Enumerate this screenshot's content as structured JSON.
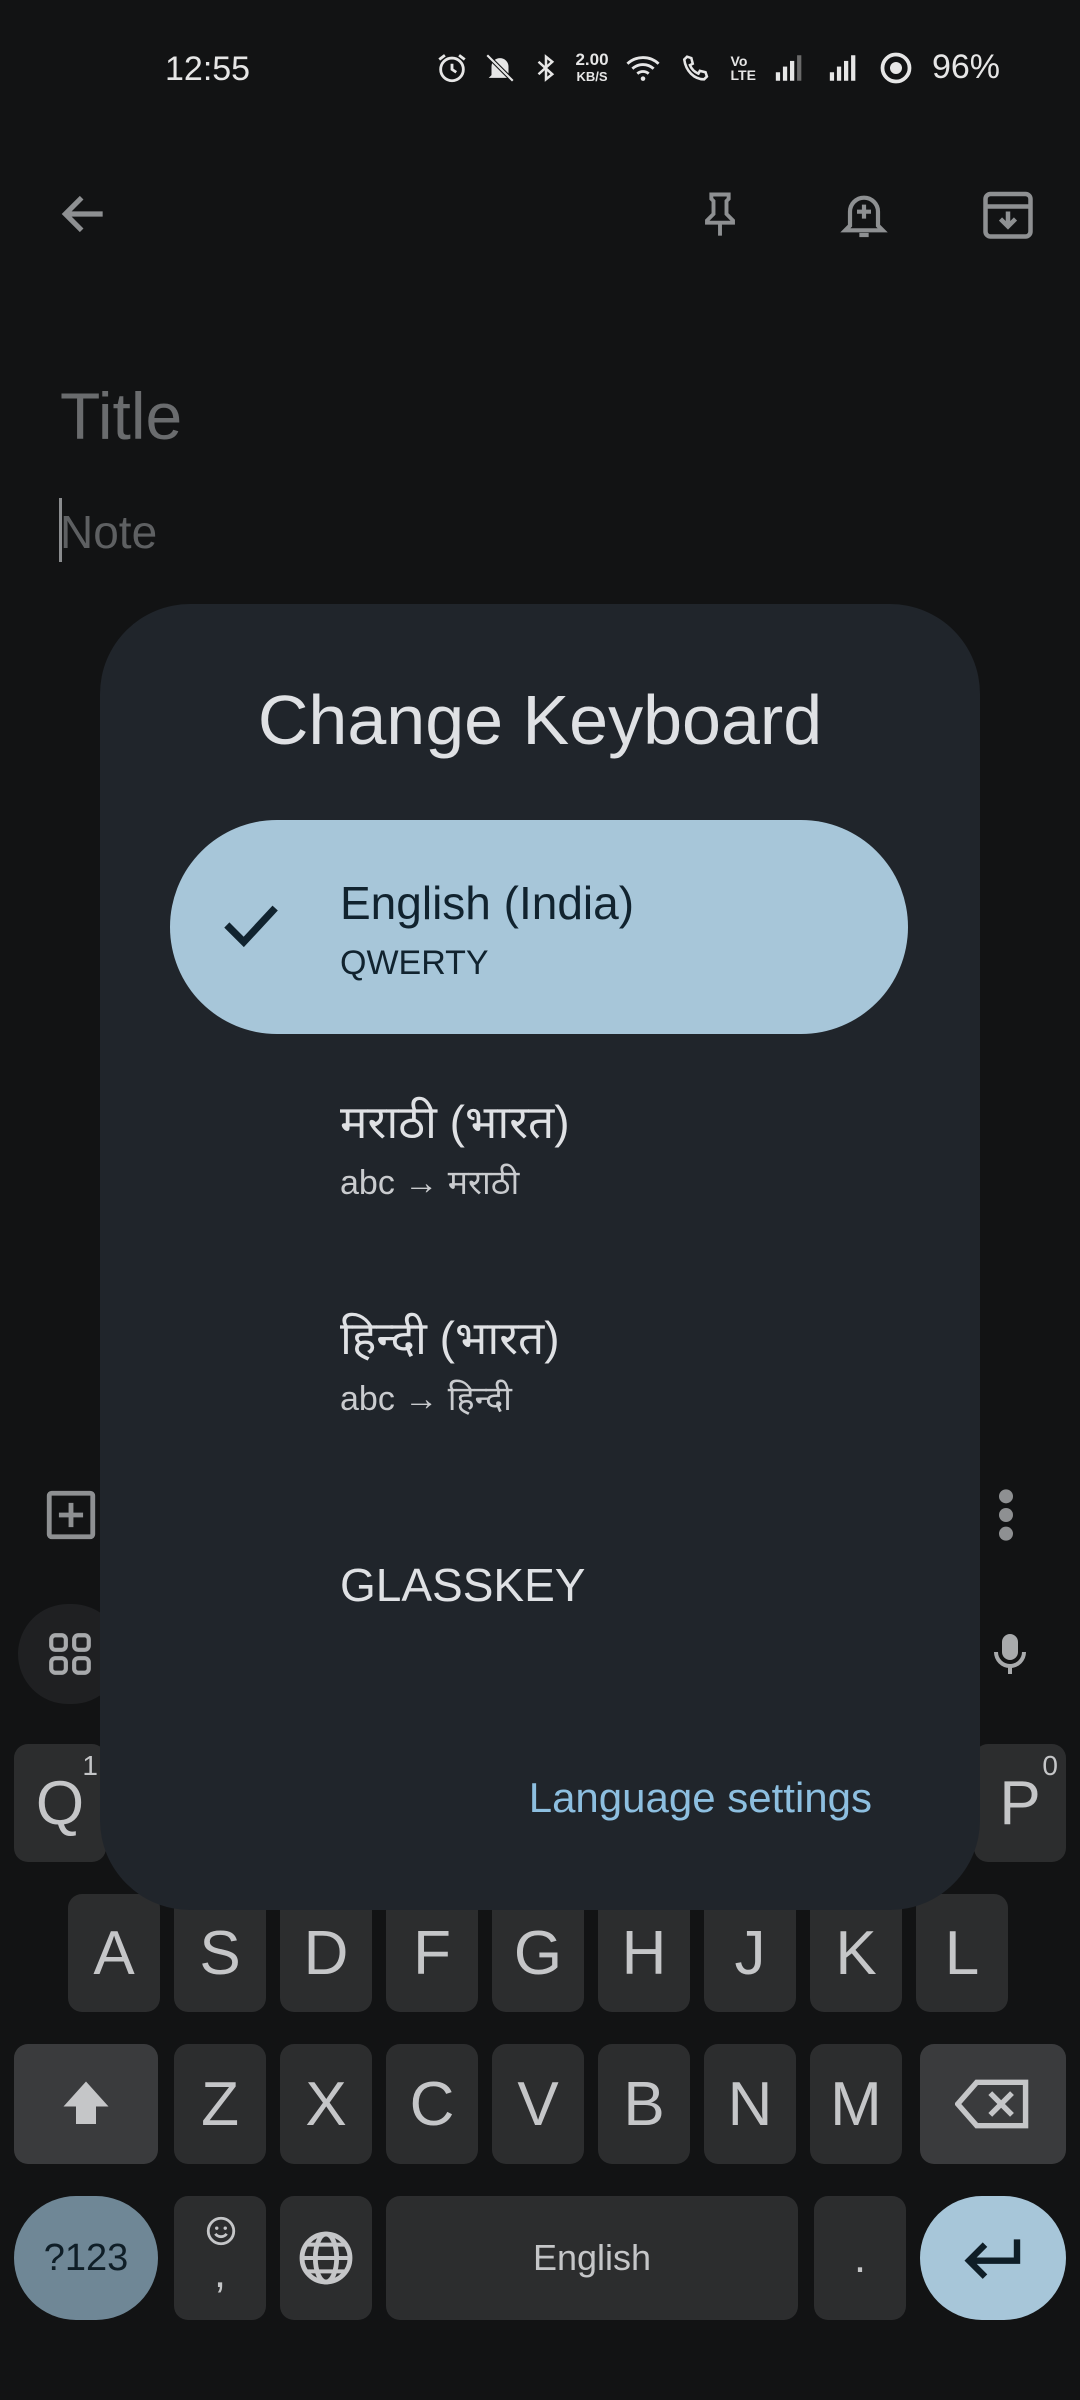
{
  "status_bar": {
    "time": "12:55",
    "network_speed_top": "2.00",
    "network_speed_bottom": "KB/S",
    "battery": "96%"
  },
  "note": {
    "title_placeholder": "Title",
    "body_placeholder": "Note"
  },
  "dialog": {
    "title": "Change Keyboard",
    "options": [
      {
        "label": "English (India)",
        "sub": "QWERTY",
        "selected": true
      },
      {
        "label": "मराठी (भारत)",
        "sub": "abc → मराठी",
        "selected": false
      },
      {
        "label": "हिन्दी (भारत)",
        "sub": "abc → हिन्दी",
        "selected": false
      },
      {
        "label": "GLASSKEY",
        "sub": "",
        "selected": false
      }
    ],
    "language_settings": "Language settings"
  },
  "keyboard": {
    "row1_left": {
      "label": "Q",
      "hint": "1"
    },
    "row1_right": {
      "label": "P",
      "hint": "0"
    },
    "row2": [
      "A",
      "S",
      "D",
      "F",
      "G",
      "H",
      "J",
      "K",
      "L"
    ],
    "row3": [
      "Z",
      "X",
      "C",
      "V",
      "B",
      "N",
      "M"
    ],
    "symbols_label": "?123",
    "comma_label": ",",
    "space_label": "English",
    "period_label": "."
  },
  "colors": {
    "accent": "#a7c6d9",
    "link": "#8dbfe0",
    "dialog_bg": "#20252b"
  }
}
